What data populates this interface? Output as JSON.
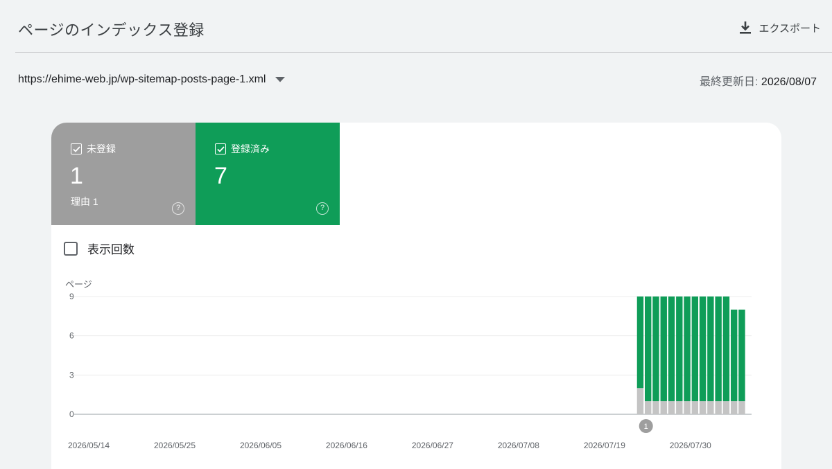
{
  "header": {
    "title": "ページのインデックス登録",
    "export_label": "エクスポート"
  },
  "filter": {
    "sitemap_url": "https://ehime-web.jp/wp-sitemap-posts-page-1.xml",
    "last_updated_label": "最終更新日:",
    "last_updated_value": "2026/08/07"
  },
  "tiles": {
    "not_indexed": {
      "label": "未登録",
      "count": "1",
      "reason": "理由 1",
      "color": "#9e9e9e"
    },
    "indexed": {
      "label": "登録済み",
      "count": "7",
      "color": "#0f9d58"
    }
  },
  "impressions_toggle": {
    "label": "表示回数",
    "checked": false
  },
  "icons": {
    "export": "download-icon",
    "dropdown": "caret-down-icon",
    "checkbox": "check-icon",
    "help": "help-circle-icon"
  },
  "chart_data": {
    "type": "bar",
    "stacked": true,
    "ylabel": "ページ",
    "yticks": [
      0,
      3,
      6,
      9
    ],
    "ylim": [
      0,
      9
    ],
    "xticks": [
      "2026/05/14",
      "2026/05/25",
      "2026/06/05",
      "2026/06/16",
      "2026/06/27",
      "2026/07/08",
      "2026/07/19",
      "2026/07/30"
    ],
    "x_start": "2026/05/14",
    "x_end": "2026/08/07",
    "series": [
      {
        "name": "未登録",
        "color": "#c4c4c4",
        "points": [
          [
            "2026/07/25",
            2
          ],
          [
            "2026/07/26",
            1
          ],
          [
            "2026/07/27",
            1
          ],
          [
            "2026/07/28",
            1
          ],
          [
            "2026/07/29",
            1
          ],
          [
            "2026/07/30",
            1
          ],
          [
            "2026/07/31",
            1
          ],
          [
            "2026/08/01",
            1
          ],
          [
            "2026/08/02",
            1
          ],
          [
            "2026/08/03",
            1
          ],
          [
            "2026/08/04",
            1
          ],
          [
            "2026/08/05",
            1
          ],
          [
            "2026/08/06",
            1
          ],
          [
            "2026/08/07",
            1
          ]
        ]
      },
      {
        "name": "登録済み",
        "color": "#0f9d58",
        "points": [
          [
            "2026/07/25",
            7
          ],
          [
            "2026/07/26",
            8
          ],
          [
            "2026/07/27",
            8
          ],
          [
            "2026/07/28",
            8
          ],
          [
            "2026/07/29",
            8
          ],
          [
            "2026/07/30",
            8
          ],
          [
            "2026/07/31",
            8
          ],
          [
            "2026/08/01",
            8
          ],
          [
            "2026/08/02",
            8
          ],
          [
            "2026/08/03",
            8
          ],
          [
            "2026/08/04",
            8
          ],
          [
            "2026/08/05",
            8
          ],
          [
            "2026/08/06",
            7
          ],
          [
            "2026/08/07",
            7
          ]
        ]
      }
    ],
    "annotations": [
      {
        "date": "2026/07/26",
        "label": "1"
      }
    ]
  }
}
